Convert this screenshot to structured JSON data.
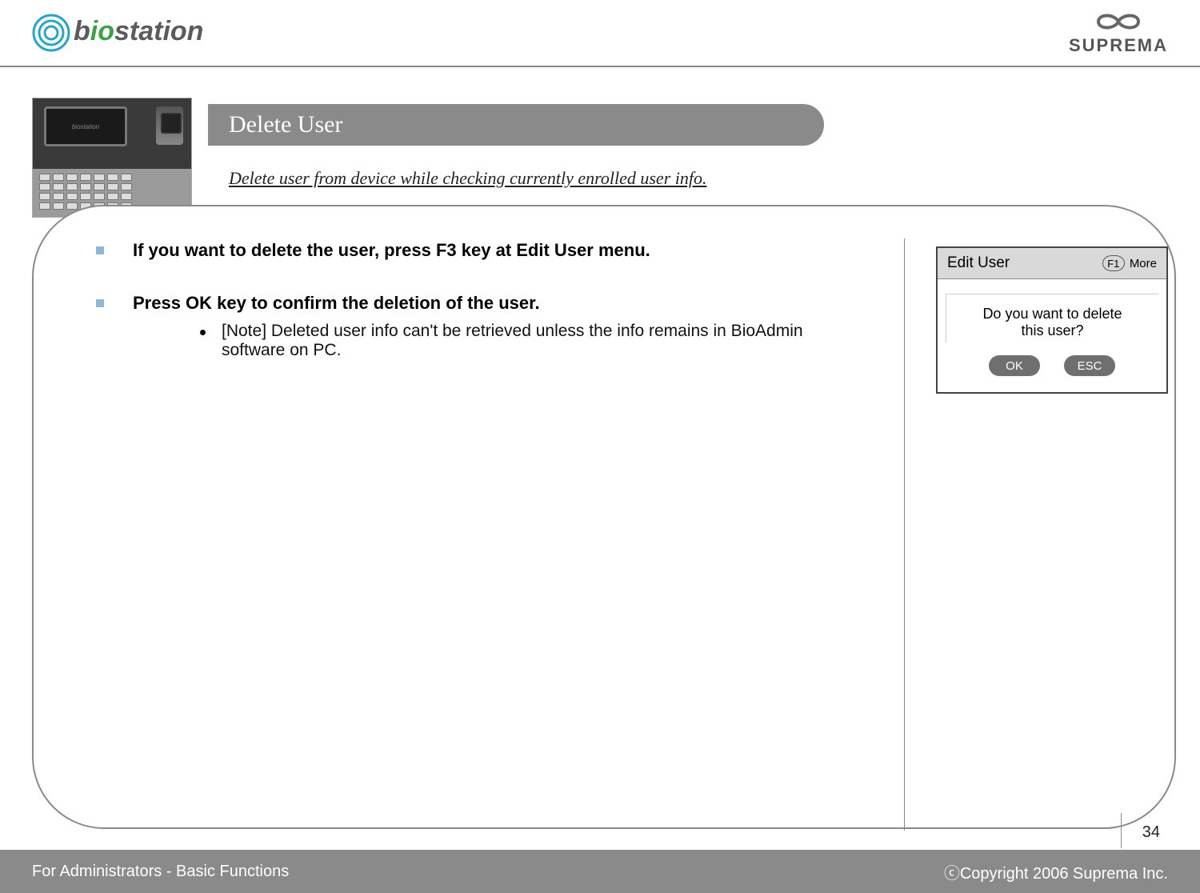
{
  "header": {
    "logo_left_text": "biostation",
    "logo_right_text": "SUPREMA"
  },
  "title": "Delete User",
  "subtitle": "Delete user from device while checking currently enrolled user info.",
  "instructions": [
    {
      "head": "If you want to delete the user, press F3 key at Edit User menu.",
      "notes": []
    },
    {
      "head": "Press OK key to confirm the deletion of the user.",
      "notes": [
        "[Note] Deleted user info can't be retrieved unless the info remains in BioAdmin software on PC."
      ]
    }
  ],
  "dialog": {
    "title": "Edit User",
    "fkey": "F1",
    "more": "More",
    "prompt_line1": "Do you want to delete",
    "prompt_line2": "this user?",
    "ok": "OK",
    "esc": "ESC"
  },
  "footer": {
    "left": "For Administrators - Basic Functions",
    "right": "ⓒCopyright 2006 Suprema Inc."
  },
  "page_number": "34",
  "thumb_screen_label": "biostation"
}
